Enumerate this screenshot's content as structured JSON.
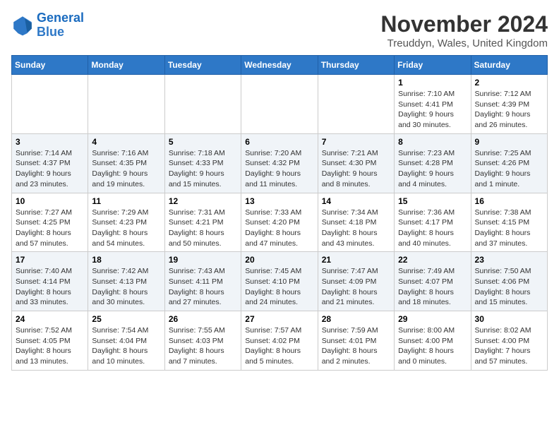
{
  "logo": {
    "line1": "General",
    "line2": "Blue"
  },
  "title": "November 2024",
  "location": "Treuddyn, Wales, United Kingdom",
  "days_of_week": [
    "Sunday",
    "Monday",
    "Tuesday",
    "Wednesday",
    "Thursday",
    "Friday",
    "Saturday"
  ],
  "weeks": [
    [
      {
        "day": "",
        "info": ""
      },
      {
        "day": "",
        "info": ""
      },
      {
        "day": "",
        "info": ""
      },
      {
        "day": "",
        "info": ""
      },
      {
        "day": "",
        "info": ""
      },
      {
        "day": "1",
        "info": "Sunrise: 7:10 AM\nSunset: 4:41 PM\nDaylight: 9 hours and 30 minutes."
      },
      {
        "day": "2",
        "info": "Sunrise: 7:12 AM\nSunset: 4:39 PM\nDaylight: 9 hours and 26 minutes."
      }
    ],
    [
      {
        "day": "3",
        "info": "Sunrise: 7:14 AM\nSunset: 4:37 PM\nDaylight: 9 hours and 23 minutes."
      },
      {
        "day": "4",
        "info": "Sunrise: 7:16 AM\nSunset: 4:35 PM\nDaylight: 9 hours and 19 minutes."
      },
      {
        "day": "5",
        "info": "Sunrise: 7:18 AM\nSunset: 4:33 PM\nDaylight: 9 hours and 15 minutes."
      },
      {
        "day": "6",
        "info": "Sunrise: 7:20 AM\nSunset: 4:32 PM\nDaylight: 9 hours and 11 minutes."
      },
      {
        "day": "7",
        "info": "Sunrise: 7:21 AM\nSunset: 4:30 PM\nDaylight: 9 hours and 8 minutes."
      },
      {
        "day": "8",
        "info": "Sunrise: 7:23 AM\nSunset: 4:28 PM\nDaylight: 9 hours and 4 minutes."
      },
      {
        "day": "9",
        "info": "Sunrise: 7:25 AM\nSunset: 4:26 PM\nDaylight: 9 hours and 1 minute."
      }
    ],
    [
      {
        "day": "10",
        "info": "Sunrise: 7:27 AM\nSunset: 4:25 PM\nDaylight: 8 hours and 57 minutes."
      },
      {
        "day": "11",
        "info": "Sunrise: 7:29 AM\nSunset: 4:23 PM\nDaylight: 8 hours and 54 minutes."
      },
      {
        "day": "12",
        "info": "Sunrise: 7:31 AM\nSunset: 4:21 PM\nDaylight: 8 hours and 50 minutes."
      },
      {
        "day": "13",
        "info": "Sunrise: 7:33 AM\nSunset: 4:20 PM\nDaylight: 8 hours and 47 minutes."
      },
      {
        "day": "14",
        "info": "Sunrise: 7:34 AM\nSunset: 4:18 PM\nDaylight: 8 hours and 43 minutes."
      },
      {
        "day": "15",
        "info": "Sunrise: 7:36 AM\nSunset: 4:17 PM\nDaylight: 8 hours and 40 minutes."
      },
      {
        "day": "16",
        "info": "Sunrise: 7:38 AM\nSunset: 4:15 PM\nDaylight: 8 hours and 37 minutes."
      }
    ],
    [
      {
        "day": "17",
        "info": "Sunrise: 7:40 AM\nSunset: 4:14 PM\nDaylight: 8 hours and 33 minutes."
      },
      {
        "day": "18",
        "info": "Sunrise: 7:42 AM\nSunset: 4:13 PM\nDaylight: 8 hours and 30 minutes."
      },
      {
        "day": "19",
        "info": "Sunrise: 7:43 AM\nSunset: 4:11 PM\nDaylight: 8 hours and 27 minutes."
      },
      {
        "day": "20",
        "info": "Sunrise: 7:45 AM\nSunset: 4:10 PM\nDaylight: 8 hours and 24 minutes."
      },
      {
        "day": "21",
        "info": "Sunrise: 7:47 AM\nSunset: 4:09 PM\nDaylight: 8 hours and 21 minutes."
      },
      {
        "day": "22",
        "info": "Sunrise: 7:49 AM\nSunset: 4:07 PM\nDaylight: 8 hours and 18 minutes."
      },
      {
        "day": "23",
        "info": "Sunrise: 7:50 AM\nSunset: 4:06 PM\nDaylight: 8 hours and 15 minutes."
      }
    ],
    [
      {
        "day": "24",
        "info": "Sunrise: 7:52 AM\nSunset: 4:05 PM\nDaylight: 8 hours and 13 minutes."
      },
      {
        "day": "25",
        "info": "Sunrise: 7:54 AM\nSunset: 4:04 PM\nDaylight: 8 hours and 10 minutes."
      },
      {
        "day": "26",
        "info": "Sunrise: 7:55 AM\nSunset: 4:03 PM\nDaylight: 8 hours and 7 minutes."
      },
      {
        "day": "27",
        "info": "Sunrise: 7:57 AM\nSunset: 4:02 PM\nDaylight: 8 hours and 5 minutes."
      },
      {
        "day": "28",
        "info": "Sunrise: 7:59 AM\nSunset: 4:01 PM\nDaylight: 8 hours and 2 minutes."
      },
      {
        "day": "29",
        "info": "Sunrise: 8:00 AM\nSunset: 4:00 PM\nDaylight: 8 hours and 0 minutes."
      },
      {
        "day": "30",
        "info": "Sunrise: 8:02 AM\nSunset: 4:00 PM\nDaylight: 7 hours and 57 minutes."
      }
    ]
  ]
}
